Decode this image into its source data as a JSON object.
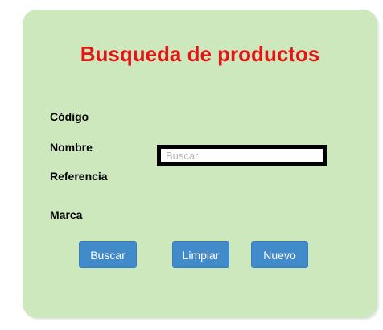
{
  "form": {
    "title": "Busqueda de productos",
    "labels": {
      "codigo": "Código",
      "nombre": "Nombre",
      "referencia": "Referencia",
      "marca": "Marca"
    },
    "search": {
      "value": "",
      "placeholder": "Buscar"
    },
    "buttons": {
      "buscar": "Buscar",
      "limpiar": "Limpiar",
      "nuevo": "Nuevo"
    }
  },
  "colors": {
    "panel_background": "#cde8bd",
    "title": "#e11616",
    "button": "#428bca"
  }
}
